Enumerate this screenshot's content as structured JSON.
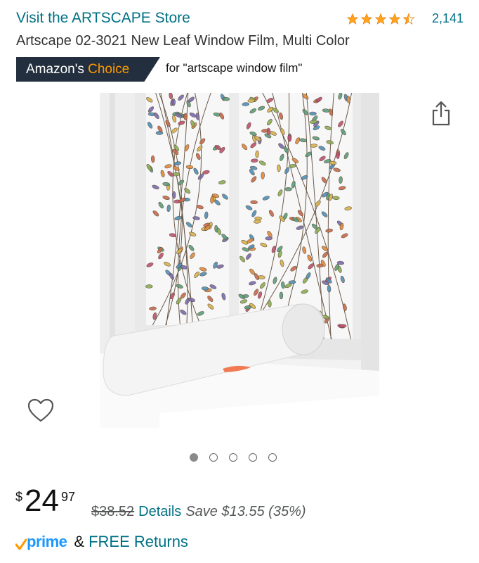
{
  "header": {
    "store_link": "Visit the ARTSCAPE Store",
    "rating_value": 4.5,
    "rating_count": "2,141"
  },
  "product": {
    "title": "Artscape 02-3021 New Leaf Window Film, Multi Color"
  },
  "choice": {
    "prefix": "Amazon's ",
    "highlight": "Choice",
    "query": "for \"artscape window film\""
  },
  "carousel": {
    "count": 5,
    "active_index": 0
  },
  "price": {
    "symbol": "$",
    "whole": "24",
    "fraction": "97",
    "list_price": "$38.52",
    "details_link": "Details",
    "savings": "Save $13.55 (35%)"
  },
  "delivery": {
    "prime_label": "prime",
    "amp": "&",
    "free_returns": "FREE Returns"
  },
  "colors": {
    "link": "#007185",
    "badge_bg": "#232f3e",
    "badge_accent": "#ff9900",
    "star": "#ffa41c",
    "prime_blue": "#1a98ff"
  },
  "icons": {
    "share": "share-icon",
    "wishlist": "heart-icon",
    "prime_check": "prime-check-icon"
  }
}
